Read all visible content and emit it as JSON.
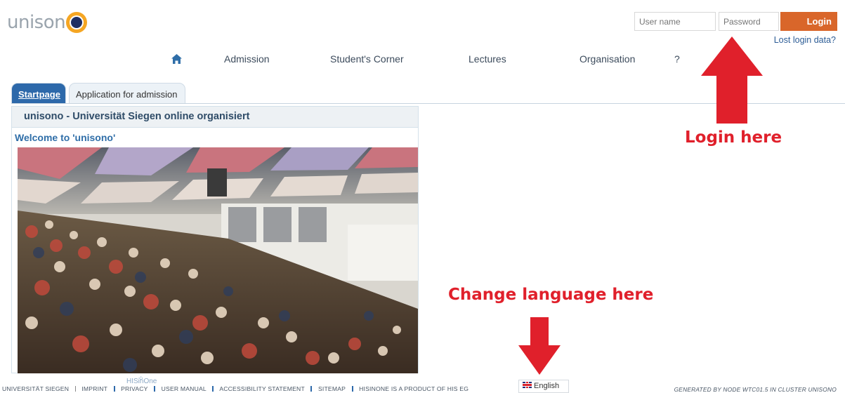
{
  "brand": {
    "logo_text": "unison",
    "accent": "#f5a623",
    "navy": "#1f2f63"
  },
  "login": {
    "username_placeholder": "User name",
    "password_placeholder": "Password",
    "button_label": "Login",
    "lost_link": "Lost login data?",
    "button_color": "#d9662a"
  },
  "nav": {
    "home_icon": "home-icon",
    "items": [
      {
        "label": "Admission"
      },
      {
        "label": "Student's Corner"
      },
      {
        "label": "Lectures"
      },
      {
        "label": "Organisation"
      },
      {
        "label": "?"
      }
    ]
  },
  "tabs": [
    {
      "label": "Startpage",
      "active": true
    },
    {
      "label": "Application for admission",
      "active": false
    }
  ],
  "panel": {
    "title": "unisono - Universität Siegen online organisiert",
    "welcome": "Welcome to 'unisono'",
    "image": "lecture-hall-photo"
  },
  "annotations": {
    "login": "Login here",
    "language": "Change language here",
    "color": "#e0202b"
  },
  "footer": {
    "product_logo": "HISinOne",
    "links": [
      "UNIVERSITÄT SIEGEN",
      "IMPRINT",
      "PRIVACY",
      "USER MANUAL",
      "ACCESSIBILITY STATEMENT",
      "SITEMAP",
      "HISINONE IS A PRODUCT OF HIS EG"
    ],
    "language": "English",
    "generated": "GENERATED BY NODE WTC01.5 IN CLUSTER UNISONO"
  }
}
